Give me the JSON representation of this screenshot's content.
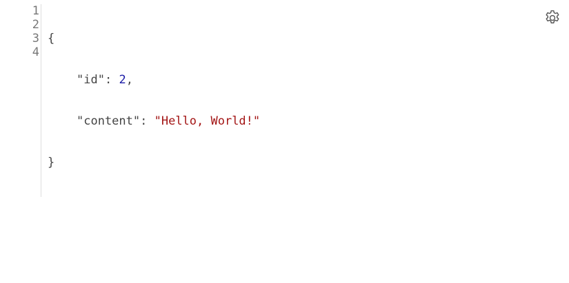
{
  "editor": {
    "line_numbers": [
      "1",
      "2",
      "3",
      "4"
    ],
    "lines": {
      "l1": {
        "open": "{"
      },
      "l2": {
        "key": "\"id\"",
        "colon": ": ",
        "value": "2",
        "comma": ","
      },
      "l3": {
        "key": "\"content\"",
        "colon": ": ",
        "value": "\"Hello, World!\""
      },
      "l4": {
        "close": "}"
      }
    }
  },
  "toolbar": {
    "settings_icon": "gear-icon"
  },
  "colors": {
    "number": "#1a1aa6",
    "string": "#a31515",
    "text": "#444444",
    "gutter_text": "#777777"
  }
}
